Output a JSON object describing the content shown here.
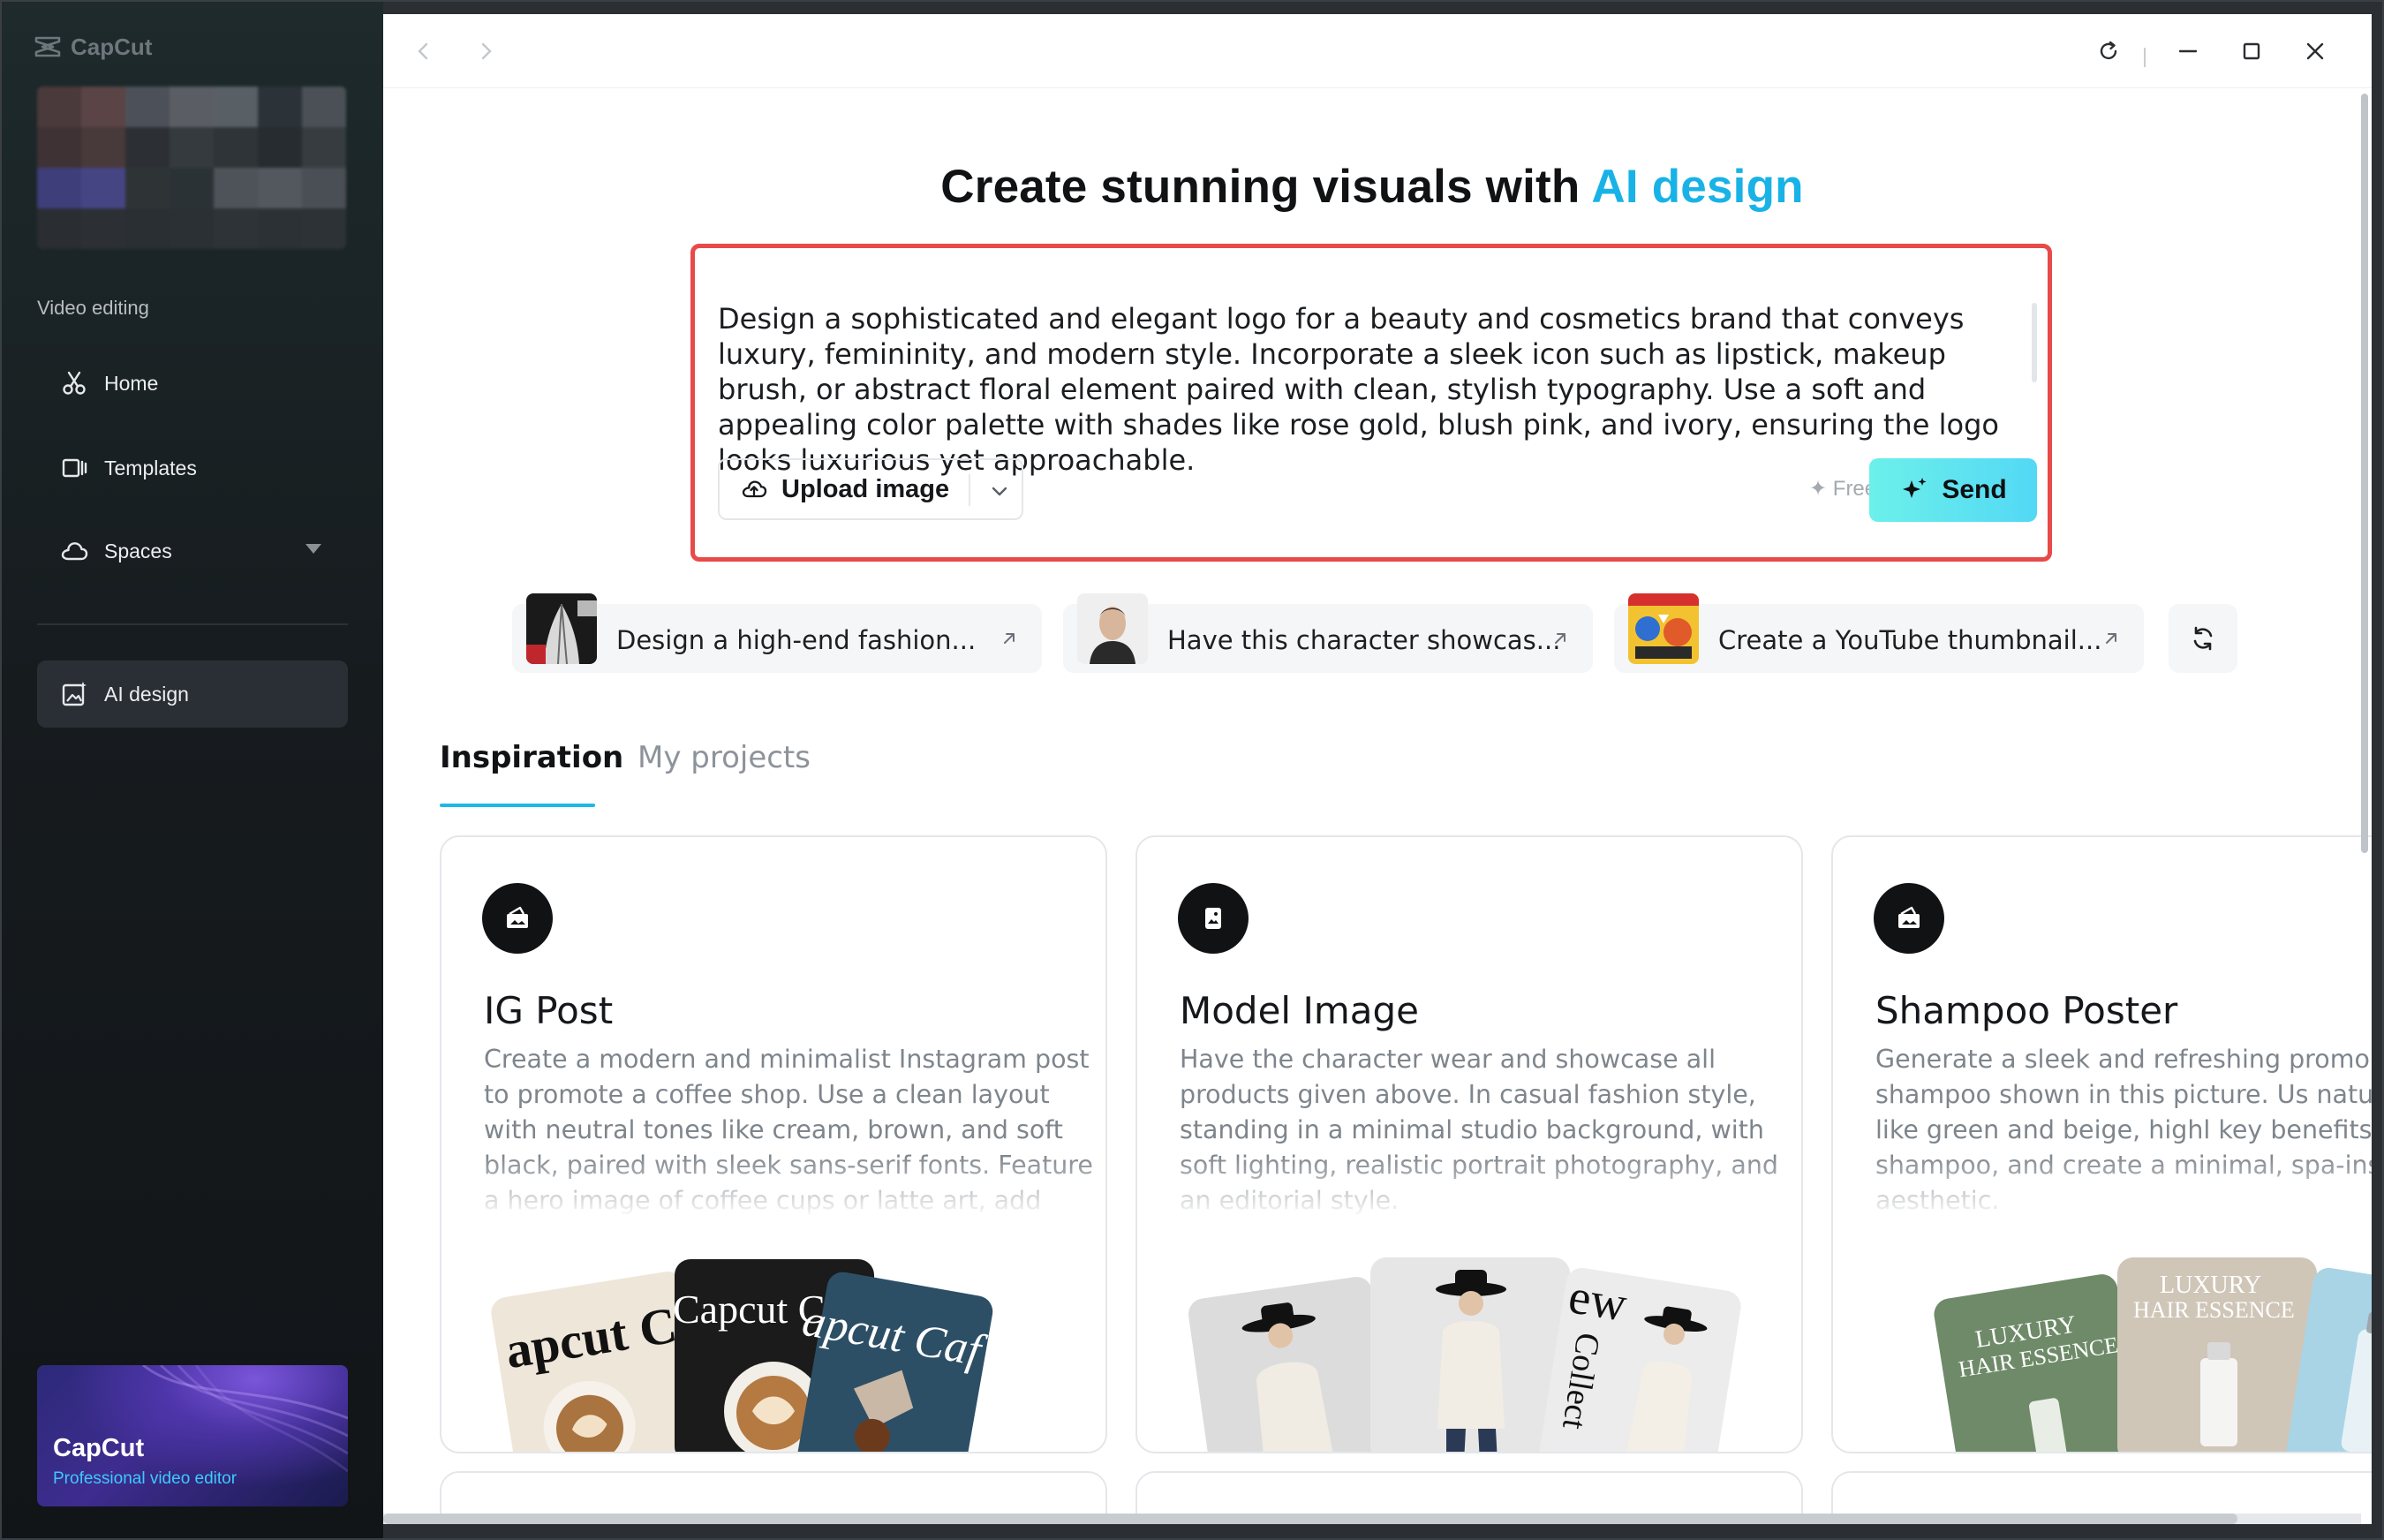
{
  "app": {
    "brand": "CapCut"
  },
  "sidebar": {
    "section_label": "Video editing",
    "items": [
      {
        "label": "Home",
        "icon": "scissors-icon"
      },
      {
        "label": "Templates",
        "icon": "template-icon"
      },
      {
        "label": "Spaces",
        "icon": "cloud-icon"
      },
      {
        "label": "AI design",
        "icon": "ai-image-icon"
      }
    ],
    "promo": {
      "title": "CapCut",
      "subtitle": "Professional video editor"
    }
  },
  "headline": {
    "prefix": "Create stunning visuals with ",
    "accent": "AI design"
  },
  "prompt": {
    "text": "Design a sophisticated and elegant logo for a beauty and cosmetics brand that conveys luxury, femininity, and modern style. Incorporate a sleek icon such as lipstick, makeup brush, or abstract floral element paired with clean, stylish typography. Use a soft and appealing color palette with shades like rose gold, blush pink, and ivory, ensuring the logo looks luxurious yet approachable.",
    "upload_label": "Upload image",
    "free_label": "✦ Free",
    "send_label": "Send"
  },
  "suggestions": [
    {
      "label": "Design a high-end fashion..."
    },
    {
      "label": "Have this character showcas..."
    },
    {
      "label": "Create a YouTube thumbnail..."
    }
  ],
  "tabs": [
    {
      "label": "Inspiration",
      "active": true
    },
    {
      "label": "My projects",
      "active": false
    }
  ],
  "cards": [
    {
      "title": "IG Post",
      "description": "Create a modern and minimalist Instagram post to promote a coffee shop. Use a clean layout with neutral tones like cream, brown, and soft black, paired with sleek sans-serif fonts. Feature a hero image of coffee cups or latte art, add",
      "art": [
        "apcut C",
        "Capcut Caf",
        "apcut Caf"
      ]
    },
    {
      "title": "Model Image",
      "description": "Have the character wear and showcase all products given above. In casual fashion style, standing in a minimal studio background, with soft lighting, realistic portrait photography, and an editorial style.",
      "art": [
        "ew",
        "Collect"
      ]
    },
    {
      "title": "Shampoo Poster",
      "description": "Generate a sleek and refreshing promo p for the shampoo shown in this picture. Us natural colors like green and beige, highl key benefits of the shampoo, and create a minimal, spa-inspired aesthetic.",
      "art": [
        "LUXURY",
        "HAIR ESSENCE",
        "LUXURY",
        "HAIR ESSENCE"
      ]
    }
  ],
  "colors": {
    "accent": "#19b2e6",
    "send_gradient_start": "#6cf0ea",
    "send_gradient_end": "#53d8f5",
    "highlight_border": "#e84a4a",
    "sidebar_bg": "#161b1e"
  }
}
